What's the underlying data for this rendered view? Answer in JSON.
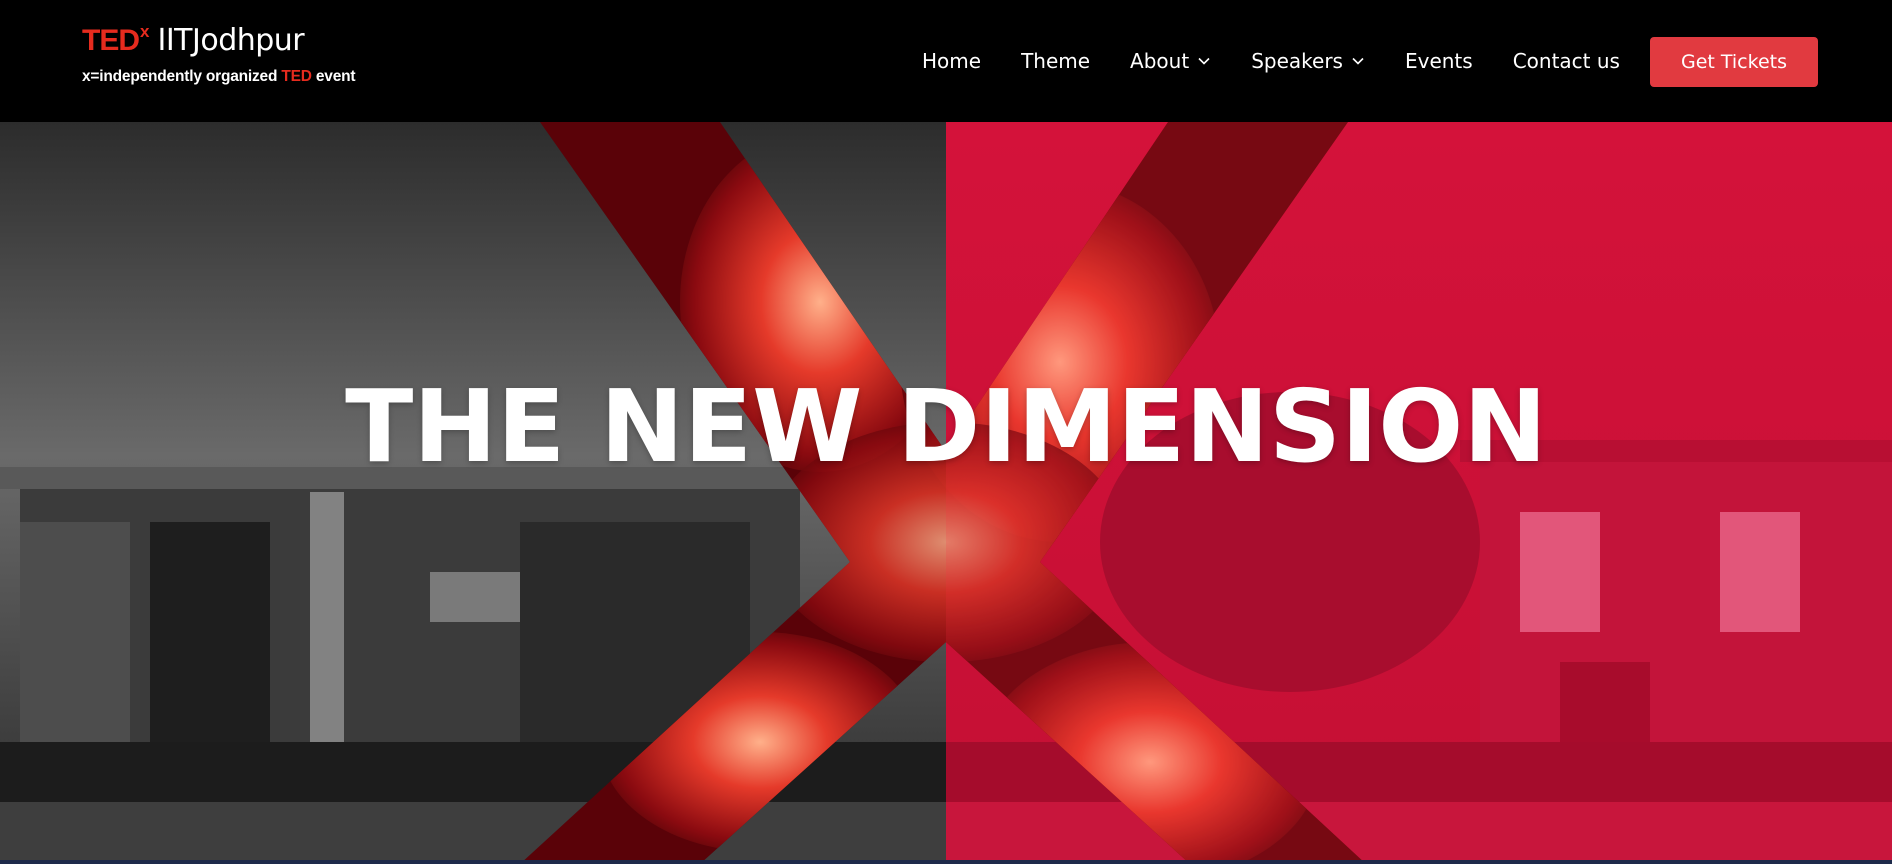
{
  "logo": {
    "ted": "TED",
    "x": "x",
    "name": "IITJodhpur",
    "tagline_prefix": "x=independently organized ",
    "tagline_ted": "TED",
    "tagline_suffix": " event"
  },
  "nav": {
    "items": [
      {
        "label": "Home",
        "dropdown": false
      },
      {
        "label": "Theme",
        "dropdown": false
      },
      {
        "label": "About",
        "dropdown": true
      },
      {
        "label": "Speakers",
        "dropdown": true
      },
      {
        "label": "Events",
        "dropdown": false
      },
      {
        "label": "Contact us",
        "dropdown": false
      }
    ],
    "cta_label": "Get Tickets"
  },
  "hero": {
    "title": "THE NEW DIMENSION"
  },
  "colors": {
    "ted_red": "#e62b1e",
    "cta_red": "#e13a40",
    "hero_red": "#d8143a",
    "header_bg": "#000000"
  },
  "icons": {
    "dropdown": "chevron-down-icon"
  }
}
